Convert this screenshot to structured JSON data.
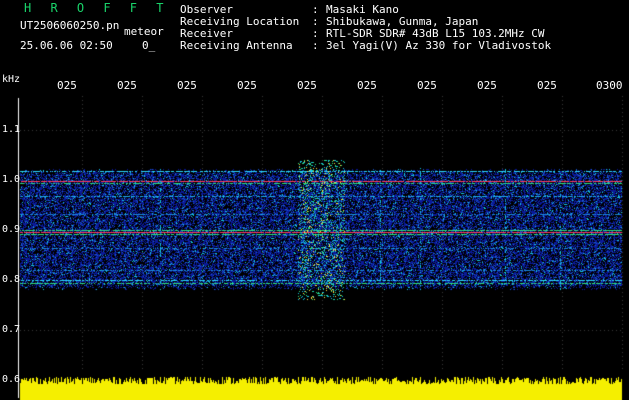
{
  "header": {
    "title": "H R O F F T",
    "file_name": "UT2506060250.pn",
    "mode": "meteor",
    "date_time": "25.06.06 02:50",
    "count": "0_"
  },
  "info": [
    {
      "label": "Observer",
      "value": "Masaki Kano"
    },
    {
      "label": "Receiving Location",
      "value": "Shibukawa, Gunma, Japan"
    },
    {
      "label": "Receiver",
      "value": "RTL-SDR SDR# 43dB L15 103.2MHz CW"
    },
    {
      "label": "Receiving Antenna",
      "value": "3el Yagi(V) Az 330 for Vladivostok"
    }
  ],
  "chart_data": {
    "type": "heatmap",
    "ylabel": "kHz",
    "y_ticks": [
      "1.1",
      "1.0",
      "0.9",
      "0.8",
      "0.7",
      "0.6"
    ],
    "x_ticks": [
      "025",
      "025",
      "025",
      "025",
      "025",
      "025",
      "025",
      "025",
      "025",
      "0300"
    ],
    "ylim": [
      0.6,
      1.15
    ],
    "grid": true,
    "colors": {
      "background": "#000000",
      "noise_low": "#0b1a9a",
      "noise_high": "#14c8e0",
      "strong": "#ff3a5a",
      "mid": "#2ee07a",
      "power": "#f5ef00"
    }
  }
}
